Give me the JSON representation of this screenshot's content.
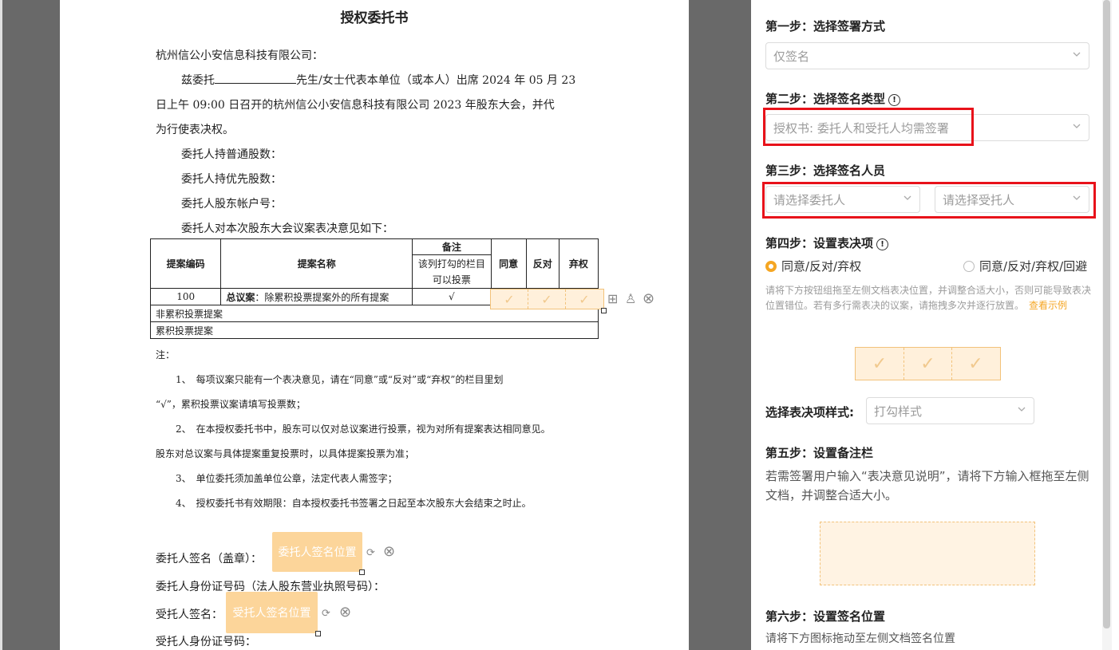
{
  "doc": {
    "title": "授权委托书",
    "addressee": "杭州信公小安信息科技有限公司：",
    "para1_a": "兹委托",
    "para1_b": "先生/女士代表本单位（或本人）出席 2024 年 05 月 23",
    "para1_line2": "日上午 09:00 日召开的杭州信公小安信息科技有限公司 2023 年股东大会，并代",
    "para1_line3": "为行使表决权。",
    "common_shares": "委托人持普通股数：",
    "preferred_shares": "委托人持优先股数：",
    "account": "委托人股东帐户号：",
    "opinion": "委托人对本次股东大会议案表决意见如下：",
    "table": {
      "col_code": "提案编码",
      "col_name": "提案名称",
      "col_note": "备注",
      "col_note_sub": "该列打勾的栏目可以投票",
      "col_agree": "同意",
      "col_against": "反对",
      "col_abstain": "弃权",
      "row1_code": "100",
      "row1_name_bold": "总议案",
      "row1_name_rest": "：除累积投票提案外的所有提案",
      "row1_note": "√",
      "row2": "非累积投票提案",
      "row3": "累积投票提案"
    },
    "note_title": "注：",
    "note1_a": "1、　每项议案只能有一个表决意见，请在“同意”或“反对”或“弃权”的栏目里划",
    "note1_b": "“√”，累积投票议案请填写投票数；",
    "note2_a": "2、　在本授权委托书中，股东可以仅对总议案进行投票，视为对所有提案表达相同意见。",
    "note2_b": "股东对总议案与具体提案重复投票时，以具体提案投票为准；",
    "note3": "3、　单位委托须加盖单位公章，法定代表人需签字；",
    "note4": "4、　授权委托书有效期限：自本授权委托书签署之日起至本次股东大会结束之时止。",
    "principal_sign": "委托人签名（盖章）：",
    "principal_sign_block": "委托人签名位置",
    "principal_id": "委托人身份证号码（法人股东营业执照号码）：",
    "agent_sign": "受托人签名：",
    "agent_sign_block": "受托人签名位置",
    "agent_id": "受托人身份证号码："
  },
  "panel": {
    "step1": "第一步：选择签署方式",
    "step1_value": "仅签名",
    "step2": "第二步：选择签名类型",
    "step2_value": "授权书: 委托人和受托人均需签署",
    "step3": "第三步：选择签名人员",
    "step3_principal_placeholder": "请选择委托人",
    "step3_agent_placeholder": "请选择受托人",
    "step4": "第四步：设置表决项",
    "radio1": "同意/反对/弃权",
    "radio2": "同意/反对/弃权/回避",
    "step4_hint": "请将下方按钮组拖至左侧文档表决位置，并调整合适大小，否则可能导致表决位置错位。若有多行需表决的议案，请拖拽多次并逐行放置。",
    "step4_link": "查看示例",
    "style_label": "选择表决项样式:",
    "style_value": "打勾样式",
    "step5": "第五步：设置备注栏",
    "step5_desc": "若需签署用户输入“表决意见说明”，请将下方输入框拖至左侧文档，并调整合适大小。",
    "step6": "第六步：设置签名位置",
    "step6_desc": "请将下方图标拖动至左侧文档签名位置"
  },
  "colors": {
    "accent": "#f5a623",
    "highlight": "#e8121a",
    "placeholder_fill": "#fcd59a"
  }
}
